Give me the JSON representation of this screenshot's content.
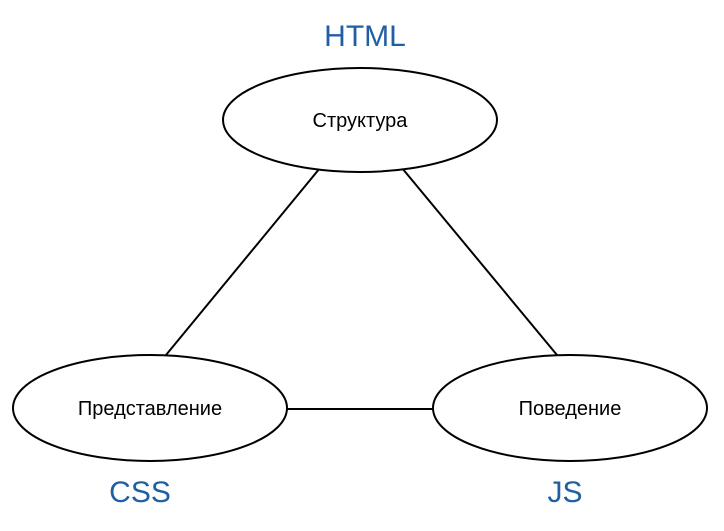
{
  "diagram": {
    "accent_color": "#1f5fa3",
    "nodes": {
      "structure": {
        "label": "Структура",
        "tech": "HTML"
      },
      "presentation": {
        "label": "Представление",
        "tech": "CSS"
      },
      "behavior": {
        "label": "Поведение",
        "tech": "JS"
      }
    },
    "edges": [
      {
        "from": "structure",
        "to": "presentation"
      },
      {
        "from": "structure",
        "to": "behavior"
      },
      {
        "from": "presentation",
        "to": "behavior"
      }
    ]
  }
}
